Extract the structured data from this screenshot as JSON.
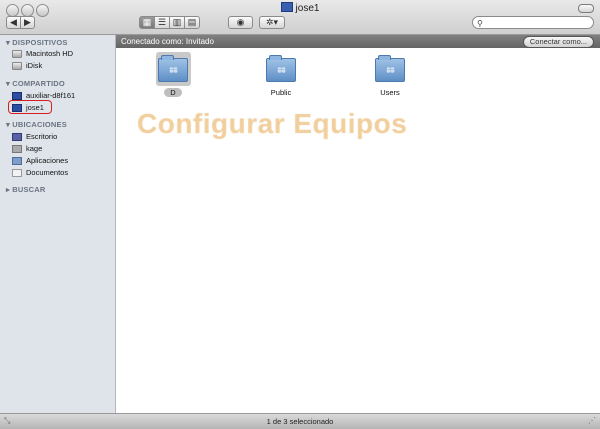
{
  "window": {
    "title": "jose1"
  },
  "toolbar": {
    "search_placeholder": "",
    "view_buttons": [
      "icon-view",
      "list-view",
      "column-view",
      "coverflow-view"
    ]
  },
  "sidebar": {
    "sections": [
      {
        "title": "DISPOSITIVOS",
        "items": [
          "Macintosh HD",
          "iDisk"
        ]
      },
      {
        "title": "COMPARTIDO",
        "items": [
          "auxiliar-d8f161",
          "jose1"
        ]
      },
      {
        "title": "UBICACIONES",
        "items": [
          "Escritorio",
          "kage",
          "Aplicaciones",
          "Documentos"
        ]
      },
      {
        "title": "BUSCAR",
        "items": []
      }
    ]
  },
  "pathbar": {
    "connected_label": "Conectado como: Invitado",
    "connect_button": "Conectar como..."
  },
  "content": {
    "folders": [
      {
        "name": "D",
        "selected": true
      },
      {
        "name": "Public",
        "selected": false
      },
      {
        "name": "Users",
        "selected": false
      }
    ],
    "watermark": "Configurar Equipos"
  },
  "statusbar": {
    "text": "1 de 3 seleccionado"
  },
  "colors": {
    "selection_ring": "#d42020",
    "pathbar": "#707070",
    "sidebar": "#dfe4ea"
  }
}
